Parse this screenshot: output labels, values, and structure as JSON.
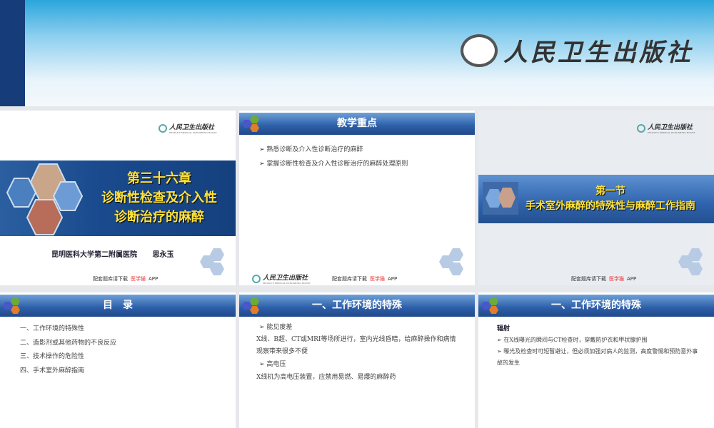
{
  "header": {
    "publisher": "人民卫生出版社"
  },
  "common": {
    "publisher_logo": "人民卫生出版社",
    "publisher_en": "PEOPLE'S MEDICAL PUBLISHING HOUSE",
    "footer_prefix": "配套题库请下载",
    "footer_app": "医学猫",
    "footer_suffix": "APP"
  },
  "slides": [
    {
      "chapter": "第三十六章",
      "title_line1": "诊断性检查及介入性",
      "title_line2": "诊断治疗的麻醉",
      "affiliation": "昆明医科大学第二附属医院",
      "author": "思永玉"
    },
    {
      "title": "教学重点",
      "bullets": [
        "熟悉诊断及介入性诊断治疗的麻醉",
        "掌握诊断性检查及介入性诊断治疗的麻醉处理原则"
      ]
    },
    {
      "section": "第一节",
      "title": "手术室外麻醉的特殊性与麻醉工作指南"
    },
    {
      "title": "目　录",
      "items": [
        "一、工作环境的特殊性",
        "二、造影剂或其他药物的不良反应",
        "三、技术操作的危险性",
        "四、手术室外麻醉指南"
      ]
    },
    {
      "title": "一、工作环境的特殊",
      "lines": [
        {
          "t": "能见度差",
          "bullet": true
        },
        {
          "t": "X线、B超、CT或MRI等场所进行，室内光线昏暗，给麻醉操作和病情观察带来很多不便",
          "bullet": false
        },
        {
          "t": "高电压",
          "bullet": true
        },
        {
          "t": "X线机为高电压装置，应禁用易燃、易爆的麻醉药",
          "bullet": false
        }
      ]
    },
    {
      "title": "一、工作环境的特殊",
      "heading": "辐射",
      "bullets": [
        "在X线曝光的瞬间与CT检查时，穿戴防护衣和甲状腺护围",
        "曝光及检查时可短暂避让，但必须加强对病人的监测，高度警惕和预防意外事故的发生"
      ]
    }
  ]
}
